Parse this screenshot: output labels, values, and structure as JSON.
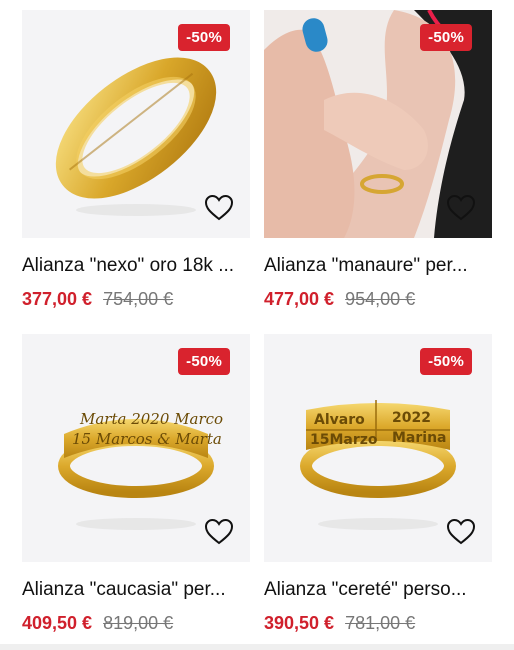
{
  "products": [
    {
      "badge": "-50%",
      "title": "Alianza \"nexo\" oro 18k ...",
      "price_now": "377,00 €",
      "price_old": "754,00 €",
      "icon": "heart-outline-icon"
    },
    {
      "badge": "-50%",
      "title": "Alianza \"manaure\" per...",
      "price_now": "477,00 €",
      "price_old": "954,00 €",
      "icon": "heart-outline-icon"
    },
    {
      "badge": "-50%",
      "title": "Alianza \"caucasia\" per...",
      "price_now": "409,50 €",
      "price_old": "819,00 €",
      "icon": "heart-outline-icon",
      "engraving": [
        "Marta 2020 Marco",
        "15 Marcos & Marta"
      ]
    },
    {
      "badge": "-50%",
      "title": "Alianza \"cereté\" perso...",
      "price_now": "390,50 €",
      "price_old": "781,00 €",
      "icon": "heart-outline-icon",
      "engraving": [
        "Alvaro",
        "2022",
        "15Marzo",
        "Marina"
      ]
    }
  ],
  "colors": {
    "badge_bg": "#d9232e",
    "price_now": "#d0202c",
    "price_old": "#777777",
    "gold": "#e2b73a"
  }
}
